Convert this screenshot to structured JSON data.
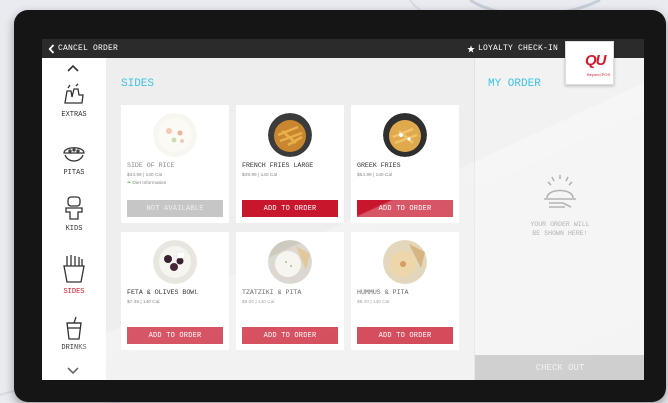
{
  "topbar": {
    "cancel_label": "CANCEL ORDER",
    "loyalty_label": "LOYALTY CHECK-IN"
  },
  "logo": {
    "mark": "QU",
    "sub": "Beyond POS",
    "color": "#d3192c"
  },
  "sidebar": {
    "items": [
      {
        "label": "EXTRAS",
        "icon": "extras-icon"
      },
      {
        "label": "PITAS",
        "icon": "pita-icon"
      },
      {
        "label": "KIDS",
        "icon": "kids-icon"
      },
      {
        "label": "SIDES",
        "icon": "fries-icon",
        "active": true
      },
      {
        "label": "DRINKS",
        "icon": "drink-icon"
      }
    ]
  },
  "section": {
    "title": "SIDES"
  },
  "products": [
    {
      "name": "SIDE OF RICE",
      "info": "$44.99 | 140 Cal",
      "diet": "Diet Information",
      "button": "NOT AVAILABLE",
      "available": false
    },
    {
      "name": "FRENCH FRIES LARGE",
      "info": "$49.99 | 140 Cal",
      "button": "ADD TO ORDER",
      "available": true
    },
    {
      "name": "GREEK FRIES",
      "info": "$54.99 | 140 Cal",
      "button": "ADD TO ORDER",
      "available": true
    },
    {
      "name": "FETA & OLIVES BOWL",
      "info": "$7.49 | 140 Cal",
      "button": "ADD TO ORDER",
      "available": true
    },
    {
      "name": "TZATZIKI & PITA",
      "info": "$8.00 | 140 Cal",
      "button": "ADD TO ORDER",
      "available": true
    },
    {
      "name": "HUMMUS & PITA",
      "info": "$8.40 | 140 Cal",
      "button": "ADD TO ORDER",
      "available": true
    }
  ],
  "order": {
    "title": "MY ORDER",
    "empty_text": "YOUR ORDER WILL\nBE SHOWN HERE!",
    "checkout_label": "CHECK OUT"
  },
  "colors": {
    "accent": "#3cc3e8",
    "brand_red": "#c8172c",
    "disabled": "#c6c6c6"
  }
}
